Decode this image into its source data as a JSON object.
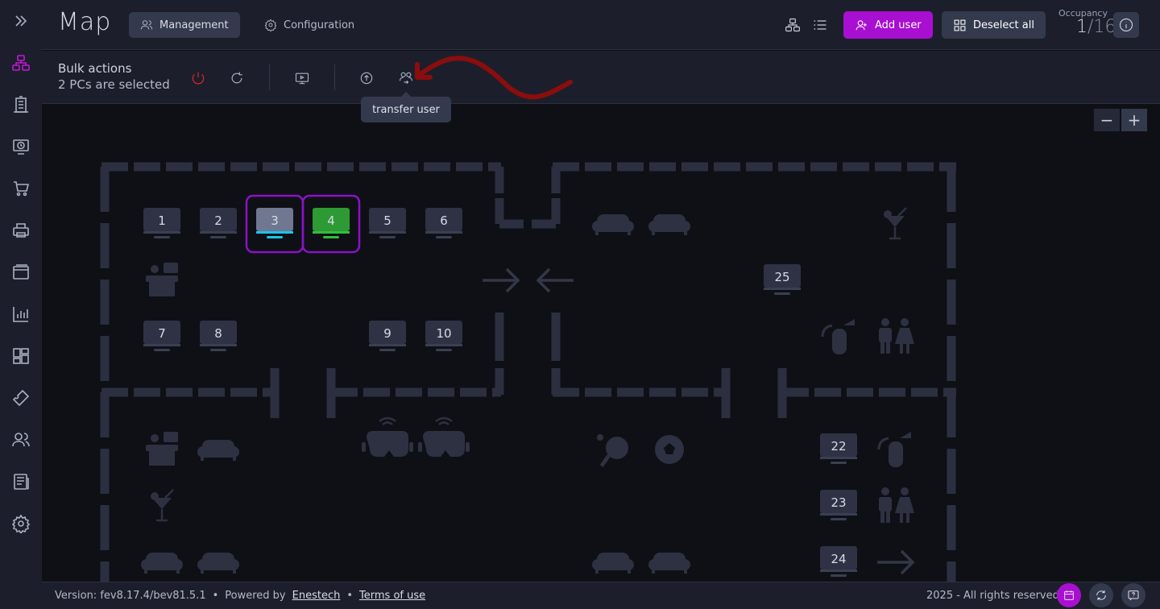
{
  "header": {
    "title": "Map",
    "tabs": [
      {
        "label": "Management",
        "icon": "users-icon",
        "active": true
      },
      {
        "label": "Configuration",
        "icon": "gear-icon",
        "active": false
      }
    ],
    "add_user_label": "Add user",
    "deselect_all_label": "Deselect all",
    "occupancy_label": "Occupancy",
    "occupancy_current": "1",
    "occupancy_total": "/16"
  },
  "sidebar": {
    "items": [
      "expand-icon",
      "map-icon",
      "building-icon",
      "clock-monitor-icon",
      "cart-icon",
      "printer-icon",
      "window-icon",
      "chart-icon",
      "dashboard-icon",
      "ticket-icon",
      "users-icon",
      "news-icon",
      "gear-icon"
    ]
  },
  "bulk": {
    "title": "Bulk actions",
    "subtitle": "2 PCs are selected",
    "tooltip": "transfer user"
  },
  "map": {
    "pcs": [
      {
        "label": "1",
        "state": "idle"
      },
      {
        "label": "2",
        "state": "idle"
      },
      {
        "label": "3",
        "state": "selected-occupied"
      },
      {
        "label": "4",
        "state": "selected-free"
      },
      {
        "label": "5",
        "state": "idle"
      },
      {
        "label": "6",
        "state": "idle"
      },
      {
        "label": "7",
        "state": "idle"
      },
      {
        "label": "8",
        "state": "idle"
      },
      {
        "label": "9",
        "state": "idle"
      },
      {
        "label": "10",
        "state": "idle"
      },
      {
        "label": "22",
        "state": "idle"
      },
      {
        "label": "23",
        "state": "idle"
      },
      {
        "label": "24",
        "state": "idle"
      },
      {
        "label": "25",
        "state": "idle"
      }
    ],
    "zoom_out": "−",
    "zoom_in": "+"
  },
  "footer": {
    "version": "Version: fev8.17.4/bev81.5.1",
    "sep1": "•",
    "powered_by": "Powered by",
    "company": "Enestech",
    "sep2": "•",
    "terms": "Terms of use",
    "rights": "2025 - All rights reserved"
  },
  "colors": {
    "accent": "#a80fd0",
    "pc_idle": "#2e3244",
    "pc_occupied": "#6f7791",
    "pc_free": "#2d9a35",
    "selection": "#8a12c8",
    "annotation_arrow": "#8b0d0d"
  }
}
